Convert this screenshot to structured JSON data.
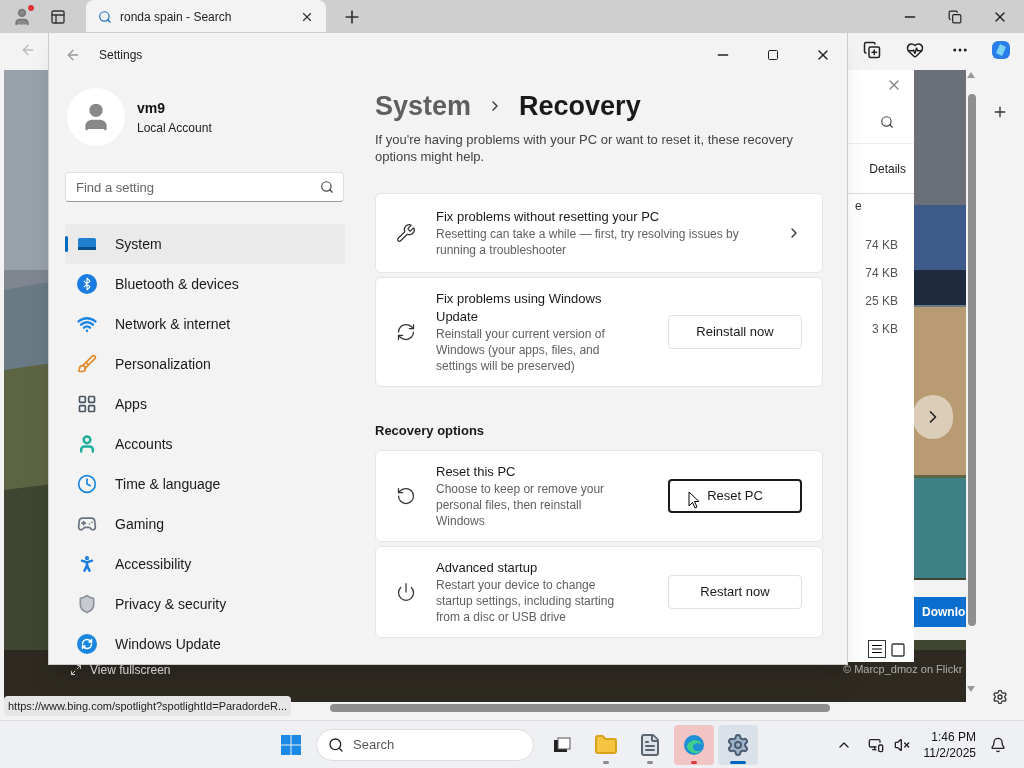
{
  "browser": {
    "tab": {
      "title": "ronda spain - Search",
      "selected": true
    }
  },
  "page": {
    "view_fullscreen": "View fullscreen",
    "photo_credit": "© Marcp_dmoz on Flickr",
    "download_button": "Downlo",
    "status_url": "https://www.bing.com/spotlight?spotlightId=ParadordeR..."
  },
  "file_panel": {
    "tab": "Details",
    "cut_heading": "e",
    "sizes": [
      "74 KB",
      "74 KB",
      "25 KB",
      "3 KB"
    ]
  },
  "settings": {
    "title": "Settings",
    "account": {
      "name": "vm9",
      "type": "Local Account"
    },
    "search_placeholder": "Find a setting",
    "nav": [
      {
        "label": "System",
        "kind": "system",
        "selected": true
      },
      {
        "label": "Bluetooth & devices",
        "kind": "bluetooth",
        "selected": false
      },
      {
        "label": "Network & internet",
        "kind": "network",
        "selected": false
      },
      {
        "label": "Personalization",
        "kind": "personalization",
        "selected": false
      },
      {
        "label": "Apps",
        "kind": "apps",
        "selected": false
      },
      {
        "label": "Accounts",
        "kind": "accounts",
        "selected": false
      },
      {
        "label": "Time & language",
        "kind": "time",
        "selected": false
      },
      {
        "label": "Gaming",
        "kind": "gaming",
        "selected": false
      },
      {
        "label": "Accessibility",
        "kind": "accessibility",
        "selected": false
      },
      {
        "label": "Privacy & security",
        "kind": "privacy",
        "selected": false
      },
      {
        "label": "Windows Update",
        "kind": "update",
        "selected": false
      }
    ],
    "breadcrumb": [
      "System",
      "Recovery"
    ],
    "intro": "If you're having problems with your PC or want to reset it, these recovery options might help.",
    "cards": [
      {
        "kind": "troubleshoot",
        "title": "Fix problems without resetting your PC",
        "description": "Resetting can take a while — first, try resolving issues by running a troubleshooter"
      },
      {
        "kind": "update",
        "title": "Fix problems using Windows Update",
        "description": "Reinstall your current version of Windows (your apps, files, and settings will be preserved)",
        "action": {
          "label": "Reinstall now",
          "focused": false
        }
      }
    ],
    "section_title": "Recovery options",
    "recovery_cards": [
      {
        "kind": "reset",
        "title": "Reset this PC",
        "description": "Choose to keep or remove your personal files, then reinstall Windows",
        "action": {
          "label": "Reset PC",
          "focused": true
        }
      },
      {
        "kind": "startup",
        "title": "Advanced startup",
        "description": "Restart your device to change startup settings, including starting from a disc or USB drive",
        "action": {
          "label": "Restart now",
          "focused": false
        }
      }
    ]
  },
  "taskbar": {
    "search_placeholder": "Search",
    "apps": [
      {
        "kind": "taskview",
        "running": false,
        "attention": false,
        "selected": false
      },
      {
        "kind": "explorer",
        "running": true,
        "attention": false,
        "selected": false
      },
      {
        "kind": "notepad",
        "running": true,
        "attention": false,
        "selected": false
      },
      {
        "kind": "edge",
        "running": true,
        "attention": true,
        "selected": false
      },
      {
        "kind": "settings",
        "running": true,
        "attention": false,
        "selected": true
      }
    ],
    "time": "1:46 PM",
    "date": "11/2/2025"
  }
}
